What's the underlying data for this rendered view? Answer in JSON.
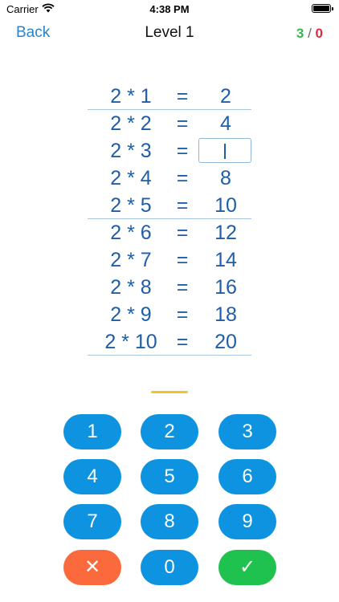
{
  "status_bar": {
    "carrier": "Carrier",
    "time": "4:38 PM"
  },
  "nav": {
    "back_label": "Back",
    "title": "Level 1",
    "score_correct": "3",
    "score_separator": "/",
    "score_wrong": "0",
    "colors": {
      "correct": "#2dbd4a",
      "wrong": "#e2293f",
      "accent": "#2b85c8"
    }
  },
  "table": {
    "rows": [
      {
        "lhs": "2 * 1",
        "eq": "=",
        "rhs": "2"
      },
      {
        "lhs": "2 * 2",
        "eq": "=",
        "rhs": "4"
      },
      {
        "lhs": "2 * 3",
        "eq": "=",
        "rhs": ""
      },
      {
        "lhs": "2 * 4",
        "eq": "=",
        "rhs": "8"
      },
      {
        "lhs": "2 * 5",
        "eq": "=",
        "rhs": "10"
      },
      {
        "lhs": "2 * 6",
        "eq": "=",
        "rhs": "12"
      },
      {
        "lhs": "2 * 7",
        "eq": "=",
        "rhs": "14"
      },
      {
        "lhs": "2 * 8",
        "eq": "=",
        "rhs": "16"
      },
      {
        "lhs": "2 * 9",
        "eq": "=",
        "rhs": "18"
      },
      {
        "lhs": "2 * 10",
        "eq": "=",
        "rhs": "20"
      }
    ]
  },
  "keypad": {
    "keys": [
      "1",
      "2",
      "3",
      "4",
      "5",
      "6",
      "7",
      "8",
      "9"
    ],
    "zero": "0",
    "clear_symbol": "✕",
    "confirm_symbol": "✓",
    "colors": {
      "digit": "#0d93e0",
      "clear": "#fa6a3c",
      "confirm": "#1fc24f"
    }
  }
}
